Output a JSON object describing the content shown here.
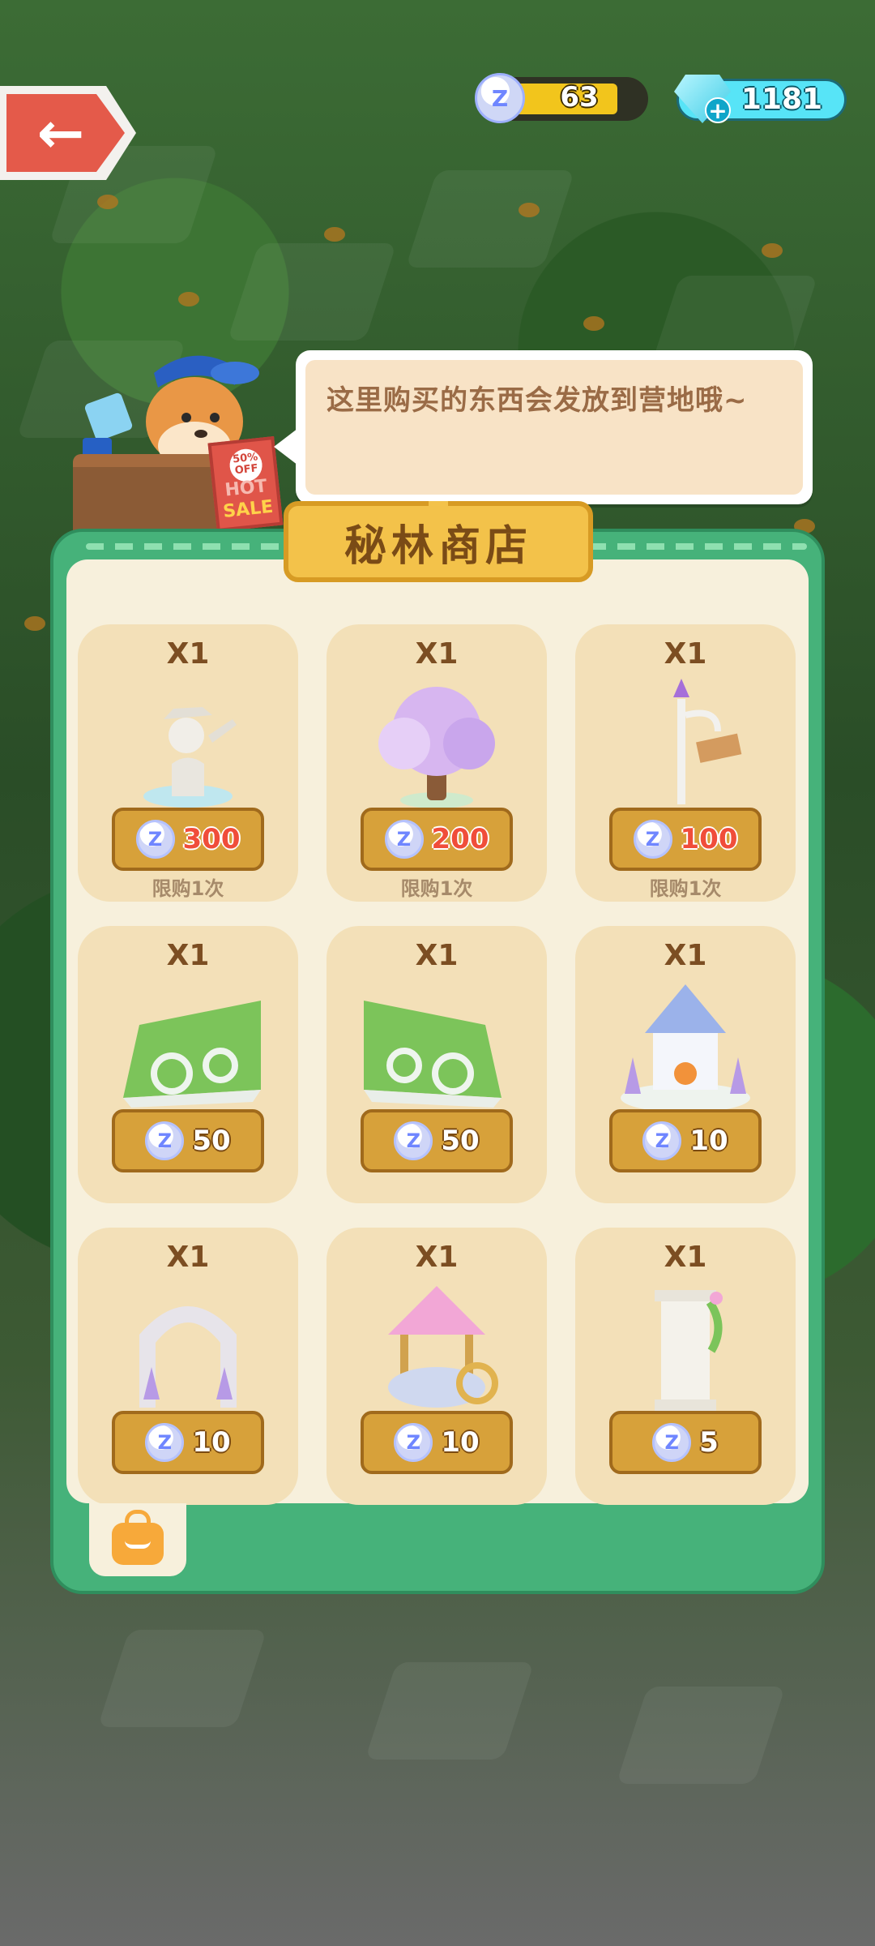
{
  "top_bar": {
    "back_icon": "arrow-left",
    "coin_amount": "63",
    "gem_amount": "1181"
  },
  "speech": {
    "text": "这里购买的东西会发放到营地哦~"
  },
  "hot_sale": {
    "pct": "50%\nOFF",
    "hot": "HOT",
    "sale": "SALE"
  },
  "shop": {
    "title": "秘林商店",
    "items": [
      {
        "qty": "X1",
        "price": "300",
        "limit": "限购1次",
        "icon": "dog-statue-fountain"
      },
      {
        "qty": "X1",
        "price": "200",
        "limit": "限购1次",
        "icon": "blossom-tree"
      },
      {
        "qty": "X1",
        "price": "100",
        "limit": "限购1次",
        "icon": "lamp-post-sign"
      },
      {
        "qty": "X1",
        "price": "50",
        "limit": "",
        "icon": "hedge-fence-left"
      },
      {
        "qty": "X1",
        "price": "50",
        "limit": "",
        "icon": "hedge-fence-right"
      },
      {
        "qty": "X1",
        "price": "10",
        "limit": "",
        "icon": "gazebo-lavender"
      },
      {
        "qty": "X1",
        "price": "10",
        "limit": "",
        "icon": "stone-arch"
      },
      {
        "qty": "X1",
        "price": "10",
        "limit": "",
        "icon": "wishing-well"
      },
      {
        "qty": "X1",
        "price": "5",
        "limit": "",
        "icon": "pillar-ivy"
      }
    ]
  },
  "bag_icon": "shopping-bag-icon",
  "colors": {
    "panel_green": "#46b27a",
    "inner_cream": "#f7f0dc",
    "card_tan": "#f3e0b8",
    "button_gold": "#d7a13a",
    "price_red": "#f04d3a"
  }
}
